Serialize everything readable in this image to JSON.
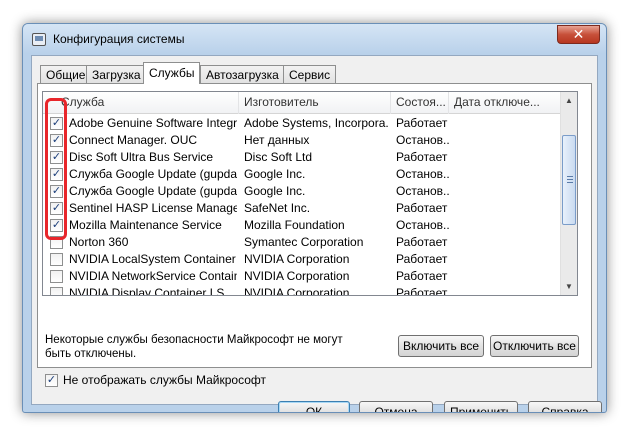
{
  "window": {
    "title": "Конфигурация системы",
    "close_glyph": "✕"
  },
  "tabs": [
    {
      "label": "Общие"
    },
    {
      "label": "Загрузка"
    },
    {
      "label": "Службы"
    },
    {
      "label": "Автозагрузка"
    },
    {
      "label": "Сервис"
    }
  ],
  "active_tab": "Службы",
  "columns": {
    "service": "Служба",
    "manufacturer": "Изготовитель",
    "status": "Состоя...",
    "disabled_date": "Дата отключе..."
  },
  "rows": [
    {
      "checked": true,
      "service": "Adobe Genuine Software Integri...",
      "manufacturer": "Adobe Systems, Incorpora...",
      "status": "Работает"
    },
    {
      "checked": true,
      "service": "Connect Manager. OUC",
      "manufacturer": "Нет данных",
      "status": "Останов..."
    },
    {
      "checked": true,
      "service": "Disc Soft Ultra Bus Service",
      "manufacturer": "Disc Soft Ltd",
      "status": "Работает"
    },
    {
      "checked": true,
      "service": "Служба Google Update (gupdate)",
      "manufacturer": "Google Inc.",
      "status": "Останов..."
    },
    {
      "checked": true,
      "service": "Служба Google Update (gupdate...",
      "manufacturer": "Google Inc.",
      "status": "Останов..."
    },
    {
      "checked": true,
      "service": "Sentinel HASP License Manager",
      "manufacturer": "SafeNet Inc.",
      "status": "Работает"
    },
    {
      "checked": true,
      "service": "Mozilla Maintenance Service",
      "manufacturer": "Mozilla Foundation",
      "status": "Останов..."
    },
    {
      "checked": false,
      "service": "Norton 360",
      "manufacturer": "Symantec Corporation",
      "status": "Работает"
    },
    {
      "checked": false,
      "service": "NVIDIA LocalSystem Container",
      "manufacturer": "NVIDIA Corporation",
      "status": "Работает"
    },
    {
      "checked": false,
      "service": "NVIDIA NetworkService Container",
      "manufacturer": "NVIDIA Corporation",
      "status": "Работает"
    },
    {
      "checked": false,
      "service": "NVIDIA Display Container LS",
      "manufacturer": "NVIDIA Corporation",
      "status": "Работает"
    }
  ],
  "note": "Некоторые службы безопасности Майкрософт не могут быть отключены.",
  "buttons": {
    "enable_all": "Включить все",
    "disable_all": "Отключить все",
    "ok": "ОК",
    "cancel": "Отмена",
    "apply": "Применить",
    "help": "Справка"
  },
  "hide_ms": {
    "checked": true,
    "label": "Не отображать службы Майкрософт"
  },
  "check_glyph": "✓",
  "colors": {
    "highlight": "#e8262b",
    "window_frame": "#b9d1ea"
  }
}
